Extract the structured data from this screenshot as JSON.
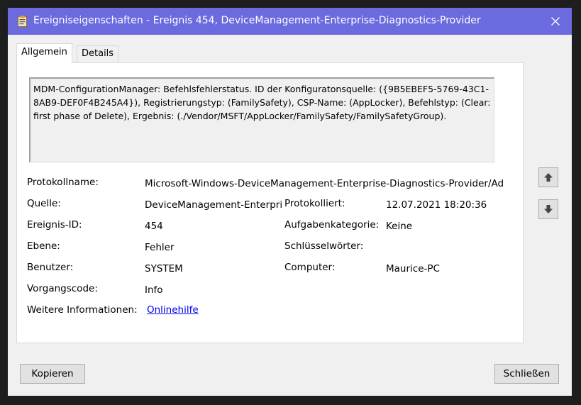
{
  "window": {
    "title": "Ereigniseigenschaften - Ereignis 454, DeviceManagement-Enterprise-Diagnostics-Provider"
  },
  "tabs": [
    {
      "label": "Allgemein",
      "active": true
    },
    {
      "label": "Details",
      "active": false
    }
  ],
  "description": "MDM-ConfigurationManager: Befehlsfehlerstatus. ID der Konfiguratonsquelle: ({9B5EBEF5-5769-43C1-8AB9-DEF0F4B245A4}), Registrierungstyp: (FamilySafety), CSP-Name: (AppLocker), Befehlstyp: (Clear: first phase of Delete), Ergebnis: (./Vendor/MSFT/AppLocker/FamilySafety/FamilySafetyGroup).",
  "fields": {
    "log_name_label": "Protokollname:",
    "log_name_value": "Microsoft-Windows-DeviceManagement-Enterprise-Diagnostics-Provider/Ad",
    "source_label": "Quelle:",
    "source_value": "DeviceManagement-Enterpri",
    "logged_label": "Protokolliert:",
    "logged_value": "12.07.2021 18:20:36",
    "event_id_label": "Ereignis-ID:",
    "event_id_value": "454",
    "task_category_label": "Aufgabenkategorie:",
    "task_category_value": "Keine",
    "level_label": "Ebene:",
    "level_value": "Fehler",
    "keywords_label": "Schlüsselwörter:",
    "keywords_value": "",
    "user_label": "Benutzer:",
    "user_value": "SYSTEM",
    "computer_label": "Computer:",
    "computer_value": "Maurice-PC",
    "opcode_label": "Vorgangscode:",
    "opcode_value": "Info",
    "more_info_label": "Weitere Informationen:",
    "more_info_link": "Onlinehilfe"
  },
  "buttons": {
    "copy": "Kopieren",
    "close": "Schließen"
  },
  "colors": {
    "titlebar": "#6b6bdf",
    "link": "#0000ee"
  }
}
